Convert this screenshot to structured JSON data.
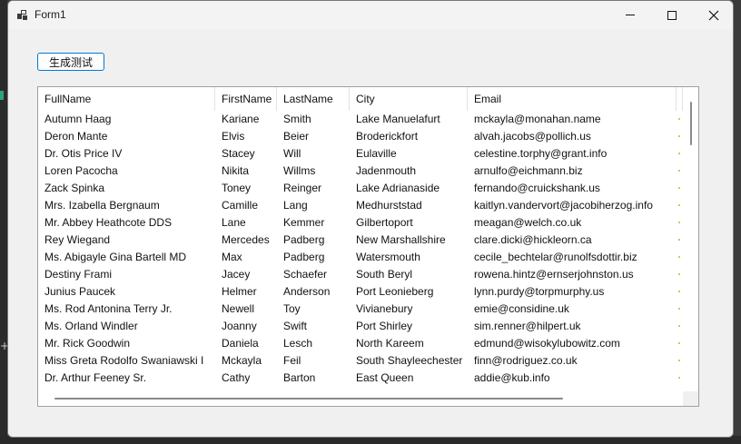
{
  "window": {
    "title": "Form1",
    "minimize_glyph": "",
    "close_glyph": "✕"
  },
  "toolbar": {
    "generate_label": "生成测试"
  },
  "grid": {
    "columns": [
      "FullName",
      "FirstName",
      "LastName",
      "City",
      "Email"
    ],
    "rows": [
      [
        "Autumn Haag",
        "Kariane",
        "Smith",
        "Lake Manuelafurt",
        "mckayla@monahan.name"
      ],
      [
        "Deron Mante",
        "Elvis",
        "Beier",
        "Broderickfort",
        "alvah.jacobs@pollich.us"
      ],
      [
        "Dr. Otis Price IV",
        "Stacey",
        "Will",
        "Eulaville",
        "celestine.torphy@grant.info"
      ],
      [
        "Loren Pacocha",
        "Nikita",
        "Willms",
        "Jadenmouth",
        "arnulfo@eichmann.biz"
      ],
      [
        "Zack Spinka",
        "Toney",
        "Reinger",
        "Lake Adrianaside",
        "fernando@cruickshank.us"
      ],
      [
        "Mrs. Izabella Bergnaum",
        "Camille",
        "Lang",
        "Medhurststad",
        "kaitlyn.vandervort@jacobiherzog.info"
      ],
      [
        "Mr. Abbey Heathcote DDS",
        "Lane",
        "Kemmer",
        "Gilbertoport",
        "meagan@welch.co.uk"
      ],
      [
        "Rey Wiegand",
        "Mercedes",
        "Padberg",
        "New Marshallshire",
        "clare.dicki@hickleorn.ca"
      ],
      [
        "Ms. Abigayle Gina Bartell MD",
        "Max",
        "Padberg",
        "Watersmouth",
        "cecile_bechtelar@runolfsdottir.biz"
      ],
      [
        "Destiny Frami",
        "Jacey",
        "Schaefer",
        "South Beryl",
        "rowena.hintz@ernserjohnston.us"
      ],
      [
        "Junius Paucek",
        "Helmer",
        "Anderson",
        "Port Leonieberg",
        "lynn.purdy@torpmurphy.us"
      ],
      [
        "Ms. Rod Antonina Terry Jr.",
        "Newell",
        "Toy",
        "Vivianebury",
        "emie@considine.uk"
      ],
      [
        "Ms. Orland Windler",
        "Joanny",
        "Swift",
        "Port Shirley",
        "sim.renner@hilpert.uk"
      ],
      [
        "Mr. Rick Goodwin",
        "Daniela",
        "Lesch",
        "North Kareem",
        "edmund@wisokylubowitz.com"
      ],
      [
        "Miss Greta Rodolfo Swaniawski I",
        "Mckayla",
        "Feil",
        "South Shayleechester",
        "finn@rodriguez.co.uk"
      ],
      [
        "Dr. Arthur Feeney Sr.",
        "Cathy",
        "Barton",
        "East Queen",
        "addie@kub.info"
      ]
    ]
  },
  "colors": {
    "button_border": "#0078d4",
    "window_bg": "#f0f0f0"
  }
}
